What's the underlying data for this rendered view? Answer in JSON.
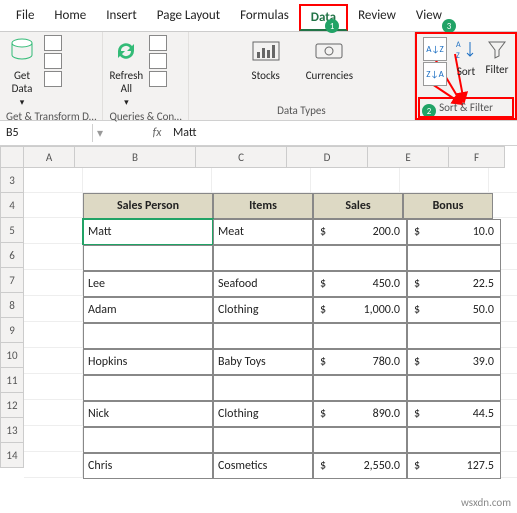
{
  "tabs": [
    "File",
    "Home",
    "Insert",
    "Page Layout",
    "Formulas",
    "Data",
    "Review",
    "View"
  ],
  "activeTab": "Data",
  "ribbon": {
    "getData": {
      "label": "Get\nData"
    },
    "refresh": {
      "label": "Refresh\nAll"
    },
    "stocks": "Stocks",
    "currencies": "Currencies",
    "sortAZ": "A→Z",
    "sortZA": "Z→A",
    "sort": "Sort",
    "filter": "Filter",
    "g1": "Get & Transform D…",
    "g2": "Queries & Con…",
    "g3": "Data Types",
    "g4": "Sort & Filter"
  },
  "badges": {
    "one": "1",
    "two": "2",
    "three": "3"
  },
  "namebox": "B5",
  "formula": "Matt",
  "cols": [
    "A",
    "B",
    "C",
    "D",
    "E",
    "F"
  ],
  "rows": [
    "3",
    "4",
    "5",
    "6",
    "7",
    "8",
    "9",
    "10",
    "11",
    "12",
    "13",
    "14"
  ],
  "headers": [
    "Sales Person",
    "Items",
    "Sales",
    "Bonus"
  ],
  "data": [
    {
      "p": "Matt",
      "i": "Meat",
      "s": "200.0",
      "b": "10.0"
    },
    {
      "p": "",
      "i": "",
      "s": "",
      "b": ""
    },
    {
      "p": "Lee",
      "i": "Seafood",
      "s": "450.0",
      "b": "22.5"
    },
    {
      "p": "Adam",
      "i": "Clothing",
      "s": "1,000.0",
      "b": "50.0"
    },
    {
      "p": "",
      "i": "",
      "s": "",
      "b": ""
    },
    {
      "p": "Hopkins",
      "i": "Baby Toys",
      "s": "780.0",
      "b": "39.0"
    },
    {
      "p": "",
      "i": "",
      "s": "",
      "b": ""
    },
    {
      "p": "Nick",
      "i": "Clothing",
      "s": "890.0",
      "b": "44.5"
    },
    {
      "p": "",
      "i": "",
      "s": "",
      "b": ""
    },
    {
      "p": "Chris",
      "i": "Cosmetics",
      "s": "2,550.0",
      "b": "127.5"
    }
  ],
  "currency": "$",
  "watermark": "wsxdn.com"
}
